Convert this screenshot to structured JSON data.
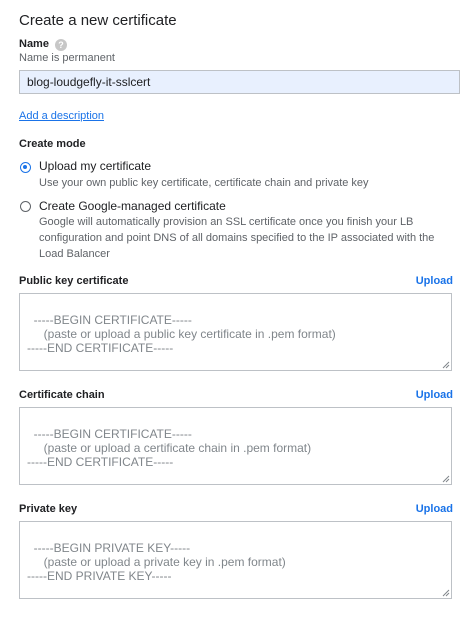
{
  "page": {
    "title": "Create a new certificate"
  },
  "name_field": {
    "label": "Name",
    "help_glyph": "?",
    "hint": "Name is permanent",
    "value": "blog-loudgefly-it-sslcert"
  },
  "add_description_link": "Add a description",
  "create_mode": {
    "label": "Create mode",
    "options": [
      {
        "label": "Upload my certificate",
        "description": "Use your own public key certificate, certificate chain and private key",
        "selected": true
      },
      {
        "label": "Create Google-managed certificate",
        "description": "Google will automatically provision an SSL certificate once you finish your LB configuration and point DNS of all domains specified to the IP associated with the Load Balancer",
        "selected": false
      }
    ]
  },
  "sections": [
    {
      "label": "Public key certificate",
      "upload_label": "Upload",
      "placeholder": "-----BEGIN CERTIFICATE-----\n     (paste or upload a public key certificate in .pem format)\n-----END CERTIFICATE-----"
    },
    {
      "label": "Certificate chain",
      "upload_label": "Upload",
      "placeholder": "-----BEGIN CERTIFICATE-----\n     (paste or upload a certificate chain in .pem format)\n-----END CERTIFICATE-----"
    },
    {
      "label": "Private key",
      "upload_label": "Upload",
      "placeholder": "-----BEGIN PRIVATE KEY-----\n     (paste or upload a private key in .pem format)\n-----END PRIVATE KEY-----"
    }
  ],
  "colors": {
    "accent": "#1a73e8",
    "input_fill": "#e8f0fe",
    "border": "#bdc1c6"
  }
}
